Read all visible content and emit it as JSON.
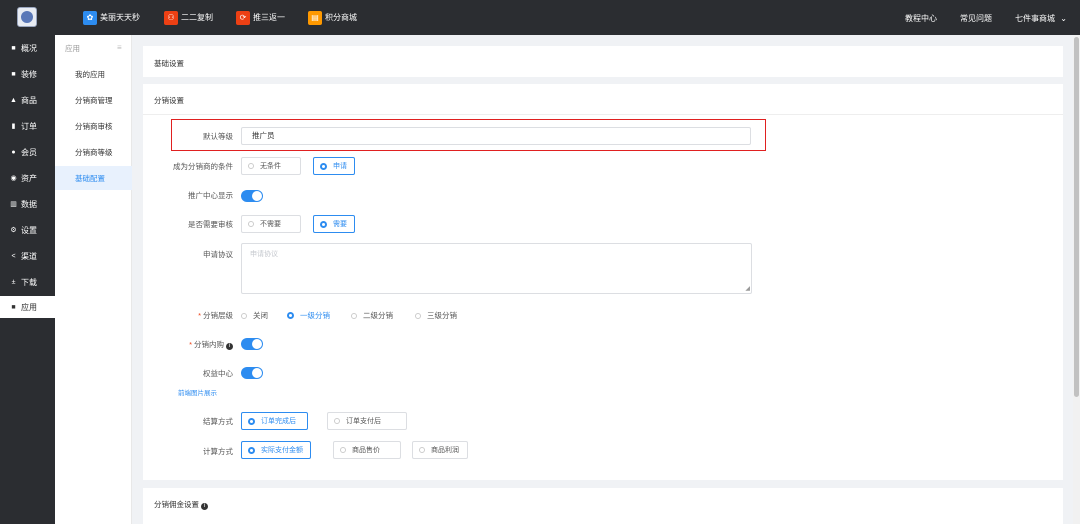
{
  "topbar": {
    "nav": [
      {
        "label": "美丽天天秒",
        "icon": "sparkle-icon",
        "color": "#2d8cf0"
      },
      {
        "label": "二二复制",
        "icon": "network-icon",
        "color": "#ed4014"
      },
      {
        "label": "推三返一",
        "icon": "share-icon",
        "color": "#ed4014"
      },
      {
        "label": "积分商城",
        "icon": "shop-icon",
        "color": "#ff9900"
      }
    ],
    "right": [
      "教程中心",
      "常见问题",
      "七件事商城"
    ]
  },
  "sidebar": {
    "items": [
      {
        "label": "概况",
        "icon": "overview-icon"
      },
      {
        "label": "装修",
        "icon": "decorate-icon"
      },
      {
        "label": "商品",
        "icon": "goods-icon"
      },
      {
        "label": "订单",
        "icon": "order-icon"
      },
      {
        "label": "会员",
        "icon": "member-icon"
      },
      {
        "label": "资产",
        "icon": "asset-icon"
      },
      {
        "label": "数据",
        "icon": "data-icon"
      },
      {
        "label": "设置",
        "icon": "settings-icon"
      },
      {
        "label": "渠道",
        "icon": "channel-icon"
      },
      {
        "label": "下载",
        "icon": "download-icon"
      },
      {
        "label": "应用",
        "icon": "app-icon"
      }
    ],
    "active": "应用"
  },
  "submenu": {
    "header": "应用",
    "items": [
      "我的应用",
      "分销商管理",
      "分销商审核",
      "分销商等级",
      "基础配置"
    ],
    "active": "基础配置"
  },
  "panels": {
    "basic_title": "基础设置",
    "dist_title": "分销设置",
    "commission_title": "分销佣金设置"
  },
  "form": {
    "default_level_label": "默认等级",
    "default_level_value": "推广员",
    "condition_label": "成为分销商的条件",
    "condition_options": [
      "无条件",
      "申请"
    ],
    "condition_selected": "申请",
    "center_show_label": "推广中心显示",
    "audit_label": "是否需要审核",
    "audit_options": [
      "不需要",
      "需要"
    ],
    "audit_selected": "需要",
    "agreement_label": "申请协议",
    "agreement_placeholder": "申请协议",
    "level_label": "分销层级",
    "level_options": [
      "关闭",
      "一级分销",
      "二级分销",
      "三级分销"
    ],
    "level_selected": "一级分销",
    "inner_buy_label": "分销内购",
    "rights_label": "权益中心",
    "front_image_link": "前端图片展示",
    "settle_label": "结算方式",
    "settle_options": [
      "订单完成后",
      "订单支付后"
    ],
    "settle_selected": "订单完成后",
    "calc_label": "计算方式",
    "calc_options": [
      "实际支付金额",
      "商品售价",
      "商品利润"
    ],
    "calc_selected": "实际支付金额",
    "toggles": {
      "center_show": true,
      "inner_buy": true,
      "rights": true
    }
  }
}
